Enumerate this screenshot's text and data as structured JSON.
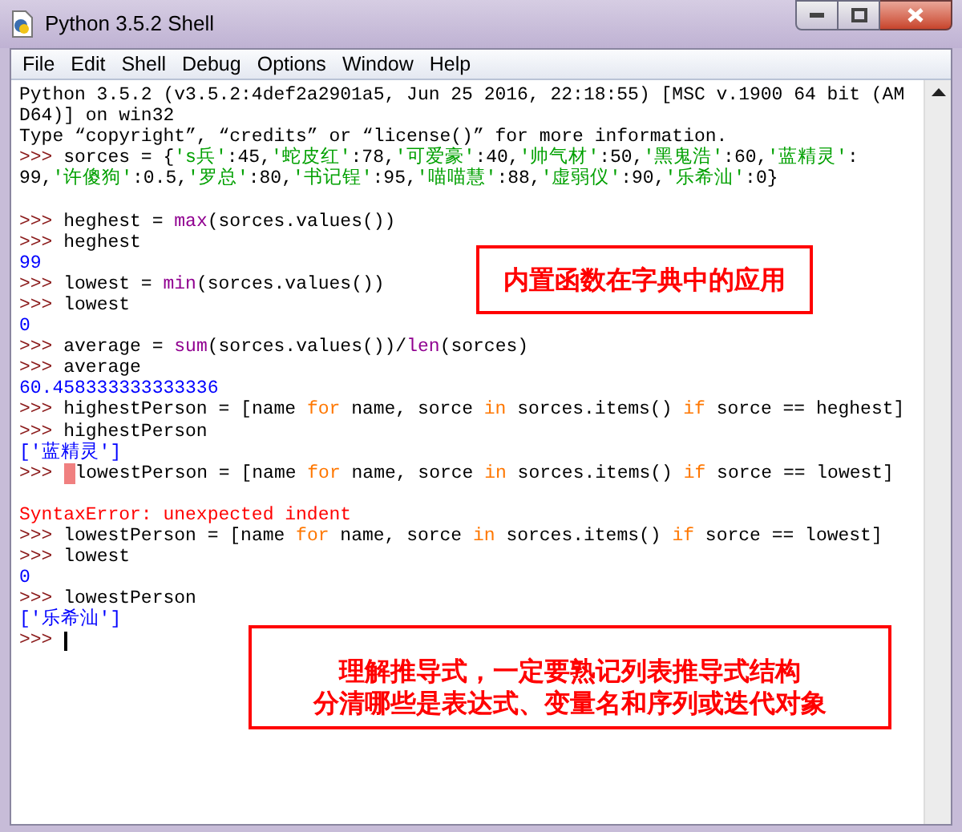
{
  "window": {
    "title": "Python 3.5.2 Shell"
  },
  "menu": [
    "File",
    "Edit",
    "Shell",
    "Debug",
    "Options",
    "Window",
    "Help"
  ],
  "console": [
    {
      "segments": [
        {
          "kind": "output_plain",
          "text": "Python 3.5.2 (v3.5.2:4def2a2901a5, Jun 25 2016, 22:18:55) [MSC v.1900 64 bit (AM"
        }
      ]
    },
    {
      "segments": [
        {
          "kind": "output_plain",
          "text": "D64)] on win32"
        }
      ]
    },
    {
      "segments": [
        {
          "kind": "output_plain",
          "text": "Type “copyright”, “credits” or “license()” for more information."
        }
      ]
    },
    {
      "segments": [
        {
          "kind": "prompt",
          "text": ">>>"
        },
        {
          "kind": "code",
          "text": " sorces = {"
        },
        {
          "kind": "string",
          "text": "'s兵'"
        },
        {
          "kind": "code",
          "text": ":45,"
        },
        {
          "kind": "string",
          "text": "'蛇皮红'"
        },
        {
          "kind": "code",
          "text": ":78,"
        },
        {
          "kind": "string",
          "text": "'可爱豪'"
        },
        {
          "kind": "code",
          "text": ":40,"
        },
        {
          "kind": "string",
          "text": "'帅气材'"
        },
        {
          "kind": "code",
          "text": ":50,"
        },
        {
          "kind": "string",
          "text": "'黑鬼浩'"
        },
        {
          "kind": "code",
          "text": ":60,"
        },
        {
          "kind": "string",
          "text": "'蓝精灵'"
        },
        {
          "kind": "code",
          "text": ":"
        }
      ]
    },
    {
      "segments": [
        {
          "kind": "code",
          "text": "99,"
        },
        {
          "kind": "string",
          "text": "'许傻狗'"
        },
        {
          "kind": "code",
          "text": ":0.5,"
        },
        {
          "kind": "string",
          "text": "'罗总'"
        },
        {
          "kind": "code",
          "text": ":80,"
        },
        {
          "kind": "string",
          "text": "'书记锃'"
        },
        {
          "kind": "code",
          "text": ":95,"
        },
        {
          "kind": "string",
          "text": "'喵喵慧'"
        },
        {
          "kind": "code",
          "text": ":88,"
        },
        {
          "kind": "string",
          "text": "'虚弱仪'"
        },
        {
          "kind": "code",
          "text": ":90,"
        },
        {
          "kind": "string",
          "text": "'乐希汕'"
        },
        {
          "kind": "code",
          "text": ":0}"
        }
      ]
    },
    {
      "gap_before": true,
      "segments": [
        {
          "kind": "prompt",
          "text": ">>>"
        },
        {
          "kind": "code",
          "text": " heghest = "
        },
        {
          "kind": "builtin",
          "text": "max"
        },
        {
          "kind": "code",
          "text": "(sorces.values())"
        }
      ]
    },
    {
      "segments": [
        {
          "kind": "prompt",
          "text": ">>>"
        },
        {
          "kind": "code",
          "text": " heghest"
        }
      ]
    },
    {
      "segments": [
        {
          "kind": "output",
          "text": "99"
        }
      ]
    },
    {
      "segments": [
        {
          "kind": "prompt",
          "text": ">>>"
        },
        {
          "kind": "code",
          "text": " lowest = "
        },
        {
          "kind": "builtin",
          "text": "min"
        },
        {
          "kind": "code",
          "text": "(sorces.values())"
        }
      ]
    },
    {
      "segments": [
        {
          "kind": "prompt",
          "text": ">>>"
        },
        {
          "kind": "code",
          "text": " lowest"
        }
      ]
    },
    {
      "segments": [
        {
          "kind": "output",
          "text": "0"
        }
      ]
    },
    {
      "segments": [
        {
          "kind": "prompt",
          "text": ">>>"
        },
        {
          "kind": "code",
          "text": " average = "
        },
        {
          "kind": "builtin",
          "text": "sum"
        },
        {
          "kind": "code",
          "text": "(sorces.values())/"
        },
        {
          "kind": "builtin",
          "text": "len"
        },
        {
          "kind": "code",
          "text": "(sorces)"
        }
      ]
    },
    {
      "segments": [
        {
          "kind": "prompt",
          "text": ">>>"
        },
        {
          "kind": "code",
          "text": " average"
        }
      ]
    },
    {
      "segments": [
        {
          "kind": "output",
          "text": "60.458333333333336"
        }
      ]
    },
    {
      "segments": [
        {
          "kind": "prompt",
          "text": ">>>"
        },
        {
          "kind": "code",
          "text": " highestPerson = [name "
        },
        {
          "kind": "keyword",
          "text": "for"
        },
        {
          "kind": "code",
          "text": " name, sorce "
        },
        {
          "kind": "keyword",
          "text": "in"
        },
        {
          "kind": "code",
          "text": " sorces.items() "
        },
        {
          "kind": "keyword",
          "text": "if"
        },
        {
          "kind": "code",
          "text": " sorce == heghest]"
        }
      ]
    },
    {
      "segments": [
        {
          "kind": "prompt",
          "text": ">>>"
        },
        {
          "kind": "code",
          "text": " highestPerson"
        }
      ]
    },
    {
      "segments": [
        {
          "kind": "output",
          "text": "['蓝精灵']"
        }
      ]
    },
    {
      "error_marker": true,
      "segments": [
        {
          "kind": "prompt",
          "text": ">>>"
        },
        {
          "kind": "code",
          "text": "lowestPerson = [name "
        },
        {
          "kind": "keyword",
          "text": "for"
        },
        {
          "kind": "code",
          "text": " name, sorce "
        },
        {
          "kind": "keyword",
          "text": "in"
        },
        {
          "kind": "code",
          "text": " sorces.items() "
        },
        {
          "kind": "keyword",
          "text": "if"
        },
        {
          "kind": "code",
          "text": " sorce == lowest]"
        }
      ]
    },
    {
      "gap_before": true,
      "segments": [
        {
          "kind": "error",
          "text": "SyntaxError: unexpected indent"
        }
      ]
    },
    {
      "segments": [
        {
          "kind": "prompt",
          "text": ">>>"
        },
        {
          "kind": "code",
          "text": " lowestPerson = [name "
        },
        {
          "kind": "keyword",
          "text": "for"
        },
        {
          "kind": "code",
          "text": " name, sorce "
        },
        {
          "kind": "keyword",
          "text": "in"
        },
        {
          "kind": "code",
          "text": " sorces.items() "
        },
        {
          "kind": "keyword",
          "text": "if"
        },
        {
          "kind": "code",
          "text": " sorce == lowest]"
        }
      ]
    },
    {
      "segments": [
        {
          "kind": "prompt",
          "text": ">>>"
        },
        {
          "kind": "code",
          "text": " lowest"
        }
      ]
    },
    {
      "segments": [
        {
          "kind": "output",
          "text": "0"
        }
      ]
    },
    {
      "segments": [
        {
          "kind": "prompt",
          "text": ">>>"
        },
        {
          "kind": "code",
          "text": " lowestPerson"
        }
      ]
    },
    {
      "segments": [
        {
          "kind": "output",
          "text": "['乐希汕']"
        }
      ]
    },
    {
      "cursor": true,
      "segments": [
        {
          "kind": "prompt",
          "text": ">>>"
        }
      ]
    }
  ],
  "annotations": [
    {
      "lines": [
        "内置函数在字典中的应用"
      ]
    },
    {
      "lines": [
        "理解推导式，一定要熟记列表推导式结构",
        "分清哪些是表达式、变量名和序列或迭代对象"
      ]
    }
  ]
}
